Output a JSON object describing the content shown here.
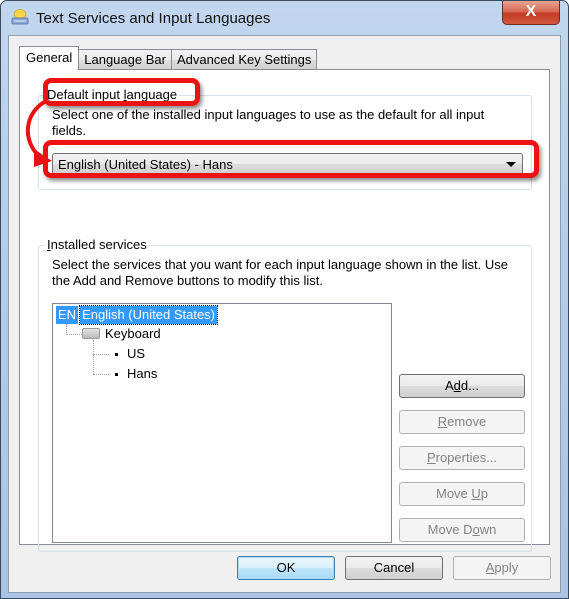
{
  "window": {
    "title": "Text Services and Input Languages",
    "close_label": "X"
  },
  "tabs": [
    {
      "label": "General",
      "active": true
    },
    {
      "label": "Language Bar",
      "active": false
    },
    {
      "label": "Advanced Key Settings",
      "active": false
    }
  ],
  "default_input_language": {
    "group_label_pre": "Default input ",
    "group_label_accel": "l",
    "group_label_post": "anguage",
    "description_line1": "Select one of the installed input languages to use as the default for all input",
    "description_line2": "fields.",
    "selected_value": "English (United States) - Hans"
  },
  "installed_services": {
    "group_label_accel": "I",
    "group_label_post": "nstalled services",
    "description_line1": "Select the services that you want for each input language shown in the list. Use",
    "description_line2": "the Add and Remove buttons to modify this list.",
    "tree": {
      "language_badge": "EN",
      "language": "English (United States)",
      "category": "Keyboard",
      "layouts": [
        "US",
        "Hans"
      ]
    },
    "buttons": {
      "add": {
        "pre": "A",
        "accel": "d",
        "post": "d...",
        "enabled": true
      },
      "remove": {
        "pre": "",
        "accel": "R",
        "post": "emove",
        "enabled": false
      },
      "properties": {
        "pre": "",
        "accel": "P",
        "post": "roperties...",
        "enabled": false
      },
      "move_up": {
        "pre": "Move ",
        "accel": "U",
        "post": "p",
        "enabled": false
      },
      "move_down": {
        "pre": "Move D",
        "accel": "o",
        "post": "wn",
        "enabled": false
      }
    }
  },
  "footer": {
    "ok": "OK",
    "cancel": "Cancel",
    "apply_accel": "A",
    "apply_post": "pply"
  },
  "annotation": {
    "highlight_color": "#ee1111"
  }
}
